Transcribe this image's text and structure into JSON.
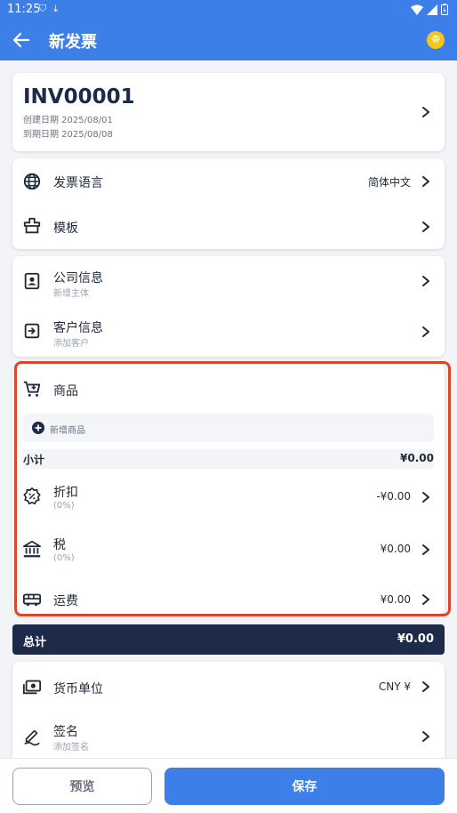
{
  "status_bar": {
    "time": "11:25"
  },
  "app_bar": {
    "title": "新发票"
  },
  "invoice": {
    "number": "INV00001",
    "created": "创建日期 2025/08/01",
    "due": "到期日期 2025/08/08"
  },
  "settings": {
    "language_label": "发票语言",
    "language_value": "简体中文",
    "template_label": "模板"
  },
  "parties": {
    "company_label": "公司信息",
    "company_sub": "新增主体",
    "client_label": "客户信息",
    "client_sub": "添加客户"
  },
  "items": {
    "title": "商品",
    "add_label": "新增商品",
    "subtotal_label": "小计",
    "subtotal_value": "¥0.00",
    "discount_label": "折扣",
    "discount_sub": "(0%)",
    "discount_value": "-¥0.00",
    "tax_label": "税",
    "tax_sub": "(0%)",
    "tax_value": "¥0.00",
    "shipping_label": "运费",
    "shipping_value": "¥0.00"
  },
  "total": {
    "label": "总计",
    "value": "¥0.00"
  },
  "extra": {
    "currency_label": "货币单位",
    "currency_value": "CNY ¥",
    "signature_label": "签名",
    "signature_sub": "添加签名"
  },
  "footer": {
    "preview": "预览",
    "save": "保存"
  },
  "colors": {
    "primary": "#3d7fe8",
    "navy": "#1e2a4a",
    "highlight": "#d9472b"
  }
}
